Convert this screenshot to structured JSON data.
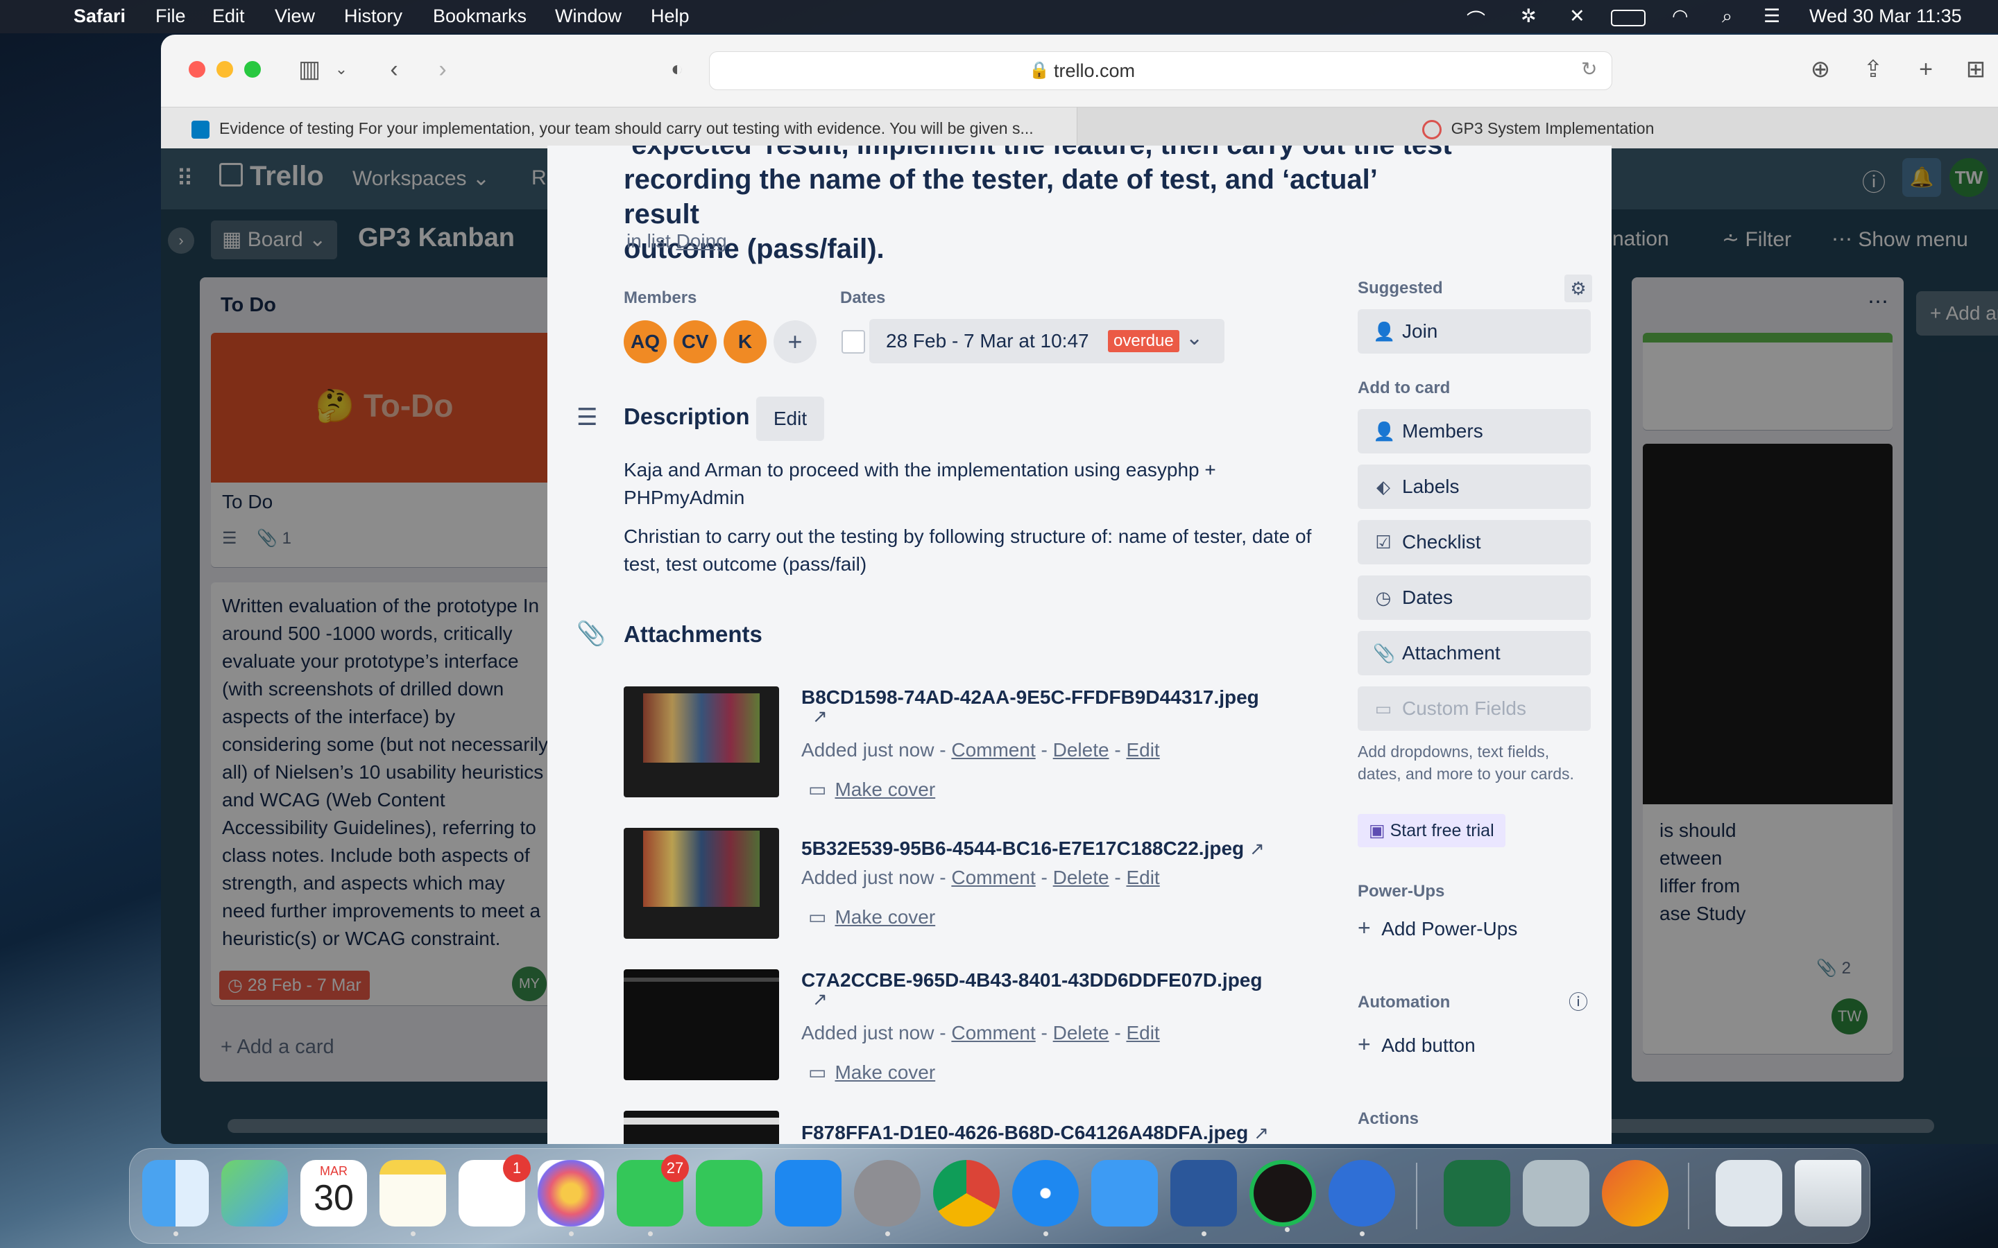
{
  "menubar": {
    "app": "Safari",
    "items": [
      "File",
      "Edit",
      "View",
      "History",
      "Bookmarks",
      "Window",
      "Help"
    ],
    "clock": "Wed 30 Mar  11:35"
  },
  "browser": {
    "url": "trello.com",
    "tabs": [
      {
        "label": "Evidence of testing For your implementation, your team should carry out testing with evidence. You will be given s..."
      },
      {
        "label": "GP3 System Implementation"
      }
    ]
  },
  "trello": {
    "logo": "Trello",
    "workspaces": "Workspaces",
    "recent_stub": "Re",
    "user_initials": "TW",
    "board_view": "Board",
    "board_name": "GP3 Kanban",
    "automation_stub": "nation",
    "filter": "Filter",
    "show_menu": "Show menu",
    "add_list": "Add another list",
    "todo_list": {
      "title": "To Do",
      "cover_text": "🤔 To-Do",
      "card1_title": "To Do",
      "card1_attachments": "1",
      "card2_text": "Written evaluation of the prototype In around 500 -1000 words, critically evaluate your prototype’s interface (with screenshots of drilled down aspects of the interface) by considering some (but not necessarily all) of Nielsen’s 10 usability heuristics and WCAG (Web Content Accessibility Guidelines), referring to class notes. Include both aspects of strength, and aspects which may need further improvements to meet a heuristic(s) or WCAG constraint.",
      "card2_due": "28 Feb - 7 Mar",
      "card2_member": "MY",
      "add_card": "Add a card"
    },
    "right_card": {
      "text_lines": [
        "is should",
        "etween",
        "liffer from",
        "ase Study"
      ],
      "attachments": "2",
      "member": "TW"
    }
  },
  "card_modal": {
    "title_lines": [
      "‘expected’ result, implement the feature, then carry out the test",
      "recording the name of the tester,  date of test, and ‘actual’ result",
      "outcome (pass/fail)."
    ],
    "in_list_prefix": "in list",
    "in_list": "Doing",
    "members_label": "Members",
    "members": [
      "AQ",
      "CV",
      "K"
    ],
    "dates_label": "Dates",
    "dates_value": "28 Feb - 7 Mar at 10:47",
    "dates_status": "overdue",
    "description_label": "Description",
    "edit_label": "Edit",
    "description_p1": "Kaja and Arman to proceed with the implementation using easyphp + PHPmyAdmin",
    "description_p2": "Christian to carry out the testing by following structure of: name of tester, date of test, test outcome (pass/fail)",
    "attachments_label": "Attachments",
    "attachments": [
      {
        "name": "B8CD1598-74AD-42AA-9E5C-FFDFB9D44317.jpeg",
        "added": "Added just now",
        "comment": "Comment",
        "delete": "Delete",
        "edit": "Edit",
        "make_cover": "Make cover"
      },
      {
        "name": "5B32E539-95B6-4544-BC16-E7E17C188C22.jpeg",
        "added": "Added just now",
        "comment": "Comment",
        "delete": "Delete",
        "edit": "Edit",
        "make_cover": "Make cover"
      },
      {
        "name": "C7A2CCBE-965D-4B43-8401-43DD6DDFE07D.jpeg",
        "added": "Added just now",
        "comment": "Comment",
        "delete": "Delete",
        "edit": "Edit",
        "make_cover": "Make cover"
      },
      {
        "name": "F878FFA1-D1E0-4626-B68D-C64126A48DFA.jpeg"
      }
    ],
    "sidebar": {
      "suggested_label": "Suggested",
      "join": "Join",
      "add_to_card_label": "Add to card",
      "members": "Members",
      "labels": "Labels",
      "checklist": "Checklist",
      "dates": "Dates",
      "attachment": "Attachment",
      "custom_fields": "Custom Fields",
      "custom_fields_hint": "Add dropdowns, text fields, dates, and more to your cards.",
      "start_trial": "Start free trial",
      "powerups_label": "Power-Ups",
      "add_powerups": "Add Power-Ups",
      "automation_label": "Automation",
      "add_button": "Add button",
      "actions_label": "Actions"
    }
  },
  "dock": {
    "calendar_month": "MAR",
    "calendar_day": "30",
    "reminders_badge": "1",
    "messages_badge": "27"
  },
  "colors": {
    "avatar_orange": "#f08a24",
    "overdue_red": "#eb5a46",
    "todo_cover": "#e8552b",
    "trello_header": "#3f6276"
  }
}
